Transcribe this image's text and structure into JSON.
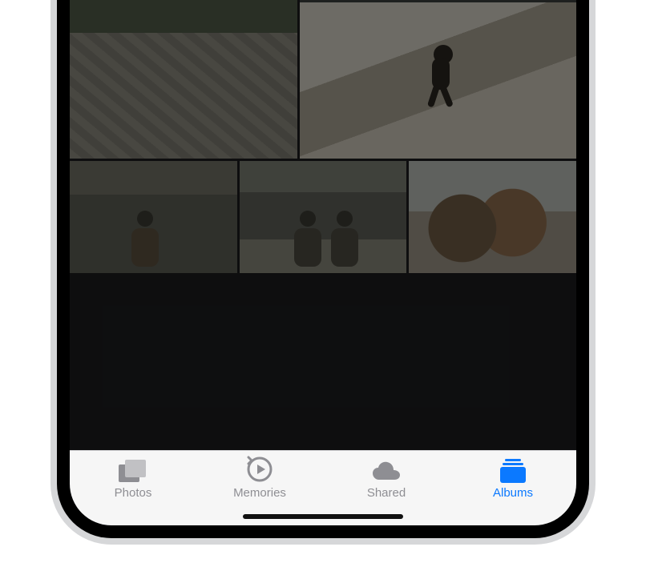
{
  "tabs": {
    "photos": {
      "label": "Photos",
      "active": false
    },
    "memories": {
      "label": "Memories",
      "active": false
    },
    "shared": {
      "label": "Shared",
      "active": false
    },
    "albums": {
      "label": "Albums",
      "active": true
    }
  },
  "colors": {
    "accent": "#0b79ff",
    "inactive": "#8e8e93"
  }
}
